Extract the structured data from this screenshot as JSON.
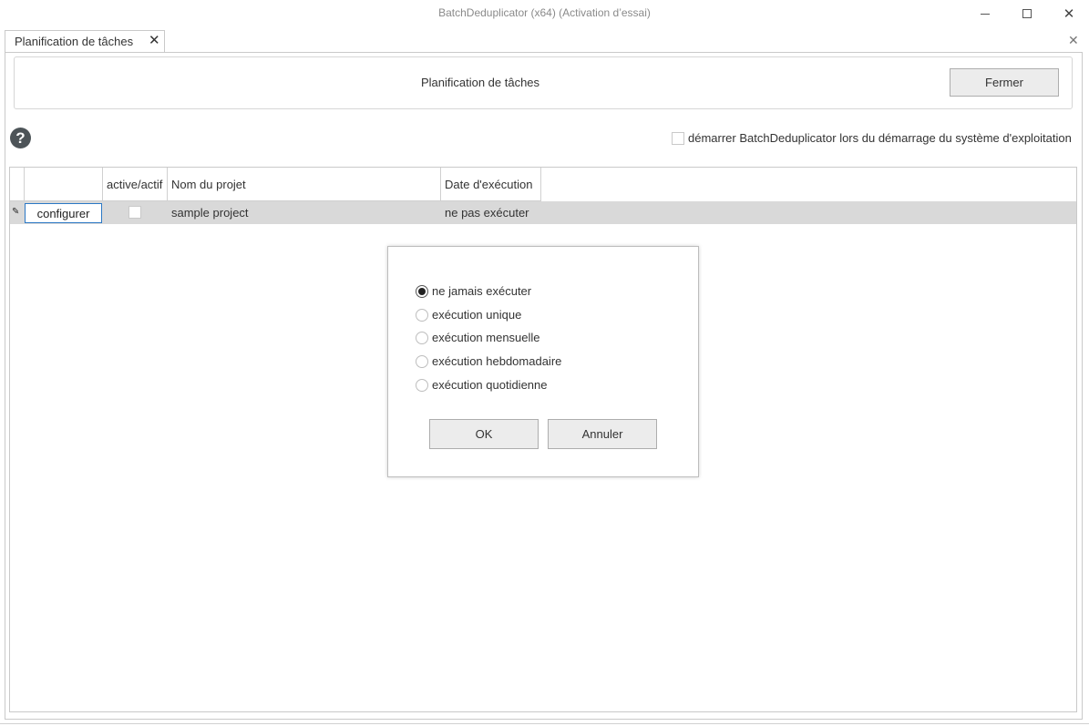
{
  "window": {
    "title": "BatchDeduplicator  (x64) (Activation d’essai)",
    "minimize": "—",
    "maximize": "☐",
    "close": "✕"
  },
  "tab": {
    "label": "Planification de tâches",
    "close": "✕",
    "strip_close": "✕"
  },
  "header": {
    "title": "Planification de tâches",
    "close_button": "Fermer"
  },
  "help": {
    "icon": "?"
  },
  "autostart": {
    "label": "démarrer BatchDeduplicator lors du démarrage du système d'exploitation",
    "checked": false
  },
  "grid": {
    "columns": [
      "",
      "active/actif",
      "Nom du projet",
      "Date d'exécution"
    ],
    "rows": [
      {
        "marker": "✎",
        "action": "configurer",
        "active": false,
        "project": "sample project",
        "date": "ne pas exécuter"
      }
    ]
  },
  "dialog": {
    "options": [
      {
        "label": "ne jamais exécuter",
        "checked": true
      },
      {
        "label": "exécution unique",
        "checked": false
      },
      {
        "label": "exécution mensuelle",
        "checked": false
      },
      {
        "label": "exécution hebdomadaire",
        "checked": false
      },
      {
        "label": "exécution quotidienne",
        "checked": false
      }
    ],
    "ok": "OK",
    "cancel": "Annuler"
  }
}
